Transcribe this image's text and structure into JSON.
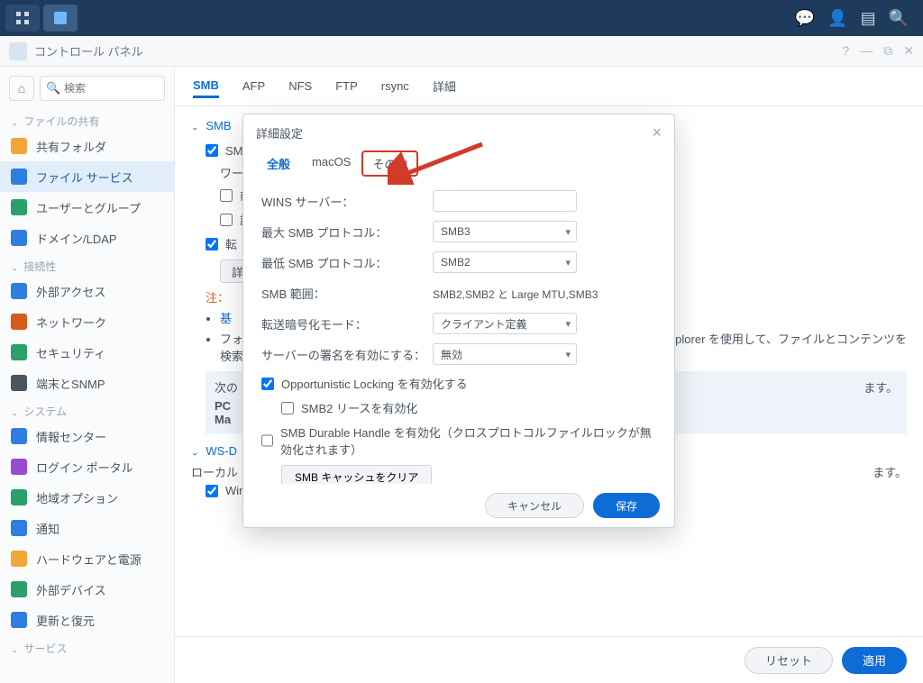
{
  "window": {
    "title": "コントロール パネル"
  },
  "search": {
    "placeholder": "検索"
  },
  "sidebar": {
    "cat1": "ファイルの共有",
    "items1": [
      {
        "label": "共有フォルダ",
        "color": "#f2a63a"
      },
      {
        "label": "ファイル サービス",
        "color": "#2f7de1",
        "active": true
      },
      {
        "label": "ユーザーとグループ",
        "color": "#2aa06a"
      },
      {
        "label": "ドメイン/LDAP",
        "color": "#2f7de1"
      }
    ],
    "cat2": "接続性",
    "items2": [
      {
        "label": "外部アクセス",
        "color": "#2f7de1"
      },
      {
        "label": "ネットワーク",
        "color": "#d65a1b"
      },
      {
        "label": "セキュリティ",
        "color": "#2aa06a"
      },
      {
        "label": "端末とSNMP",
        "color": "#4a5560"
      }
    ],
    "cat3": "システム",
    "items3": [
      {
        "label": "情報センター",
        "color": "#2f7de1"
      },
      {
        "label": "ログイン ポータル",
        "color": "#9a4bd0"
      },
      {
        "label": "地域オプション",
        "color": "#2aa06a"
      },
      {
        "label": "通知",
        "color": "#2f7de1"
      },
      {
        "label": "ハードウェアと電源",
        "color": "#f2a63a"
      },
      {
        "label": "外部デバイス",
        "color": "#2aa06a"
      },
      {
        "label": "更新と復元",
        "color": "#2f7de1"
      }
    ],
    "cat4": "サービス"
  },
  "tabs": [
    "SMB",
    "AFP",
    "NFS",
    "FTP",
    "rsync",
    "詳細"
  ],
  "main": {
    "section_smb": "SMB",
    "enable_smb": "SMB サービスを有効化",
    "workgroup_label": "ワーク",
    "prev_partial": "前",
    "allow_partial": "許",
    "transfer_log": "転",
    "detail_btn": "詳細",
    "note_heading": "注：",
    "note_item1": "基",
    "note_item2_pre": "フォ",
    "note_item2_tail": "検索",
    "note_file_explorer": "File Explorer を使用して、ファイルとコンテンツを",
    "next_pre": "次の",
    "next_tail": "ます。",
    "pc_partial": "PC",
    "ma_partial": "Ma",
    "section_ws": "WS-D",
    "local_text": "ローカル ネ",
    "local_tail": "ます。",
    "windo_partial": "Windo"
  },
  "footer": {
    "reset": "リセット",
    "apply": "適用"
  },
  "modal": {
    "title": "詳細設定",
    "tabs": {
      "general": "全般",
      "macos": "macOS",
      "other": "その他"
    },
    "wins_label": "WINS サーバー：",
    "max_smb_label": "最大 SMB プロトコル：",
    "max_smb_val": "SMB3",
    "min_smb_label": "最低 SMB プロトコル：",
    "min_smb_val": "SMB2",
    "range_label": "SMB 範囲：",
    "range_val": "SMB2,SMB2 と Large MTU,SMB3",
    "enc_label": "転送暗号化モード：",
    "enc_val": "クライアント定義",
    "sign_label": "サーバーの署名を有効にする：",
    "sign_val": "無効",
    "oplock": "Opportunistic Locking を有効化する",
    "smb2lease": "SMB2 リースを有効化",
    "durable": "SMB Durable Handle を有効化（クロスプロトコルファイルロックが無効化されます）",
    "clear_cache": "SMB キャッシュをクリア",
    "cancel": "キャンセル",
    "save": "保存"
  }
}
